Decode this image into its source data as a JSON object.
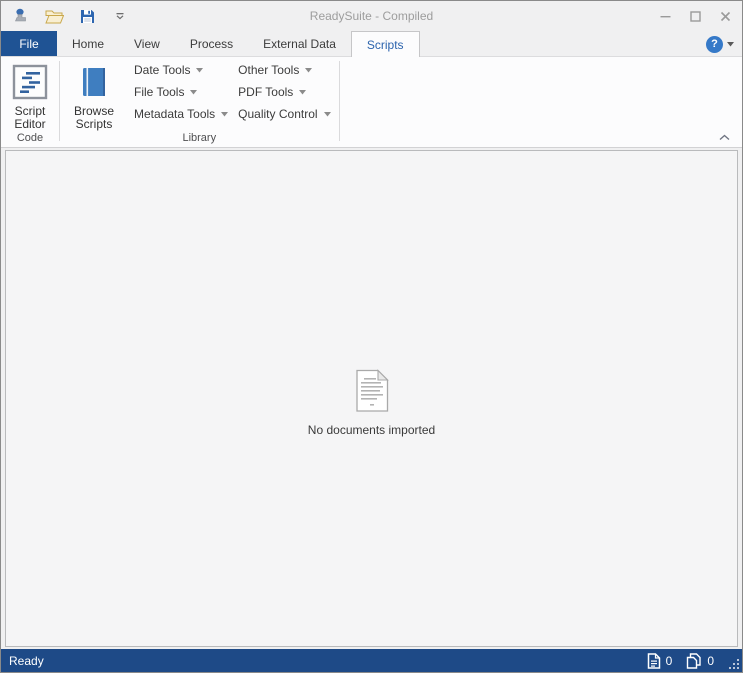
{
  "window": {
    "title": "ReadySuite - Compiled"
  },
  "tabs": {
    "items": [
      "File",
      "Home",
      "View",
      "Process",
      "External Data",
      "Scripts"
    ],
    "active": "Scripts"
  },
  "ribbon": {
    "groups": {
      "code": "Code",
      "library": "Library"
    },
    "buttons": {
      "script_editor": "Script Editor",
      "browse_scripts": "Browse Scripts"
    },
    "dropdowns": [
      "Date Tools",
      "File Tools",
      "Metadata Tools",
      "Other Tools",
      "PDF Tools",
      "Quality Control"
    ]
  },
  "help": {
    "glyph": "?"
  },
  "content": {
    "empty_message": "No documents imported"
  },
  "statusbar": {
    "status": "Ready",
    "documents_count": "0",
    "pages_count": "0"
  },
  "icons": {
    "quick_access": [
      "app-stamp-icon",
      "open-folder-icon",
      "save-icon",
      "qat-more-icon"
    ],
    "window_controls": [
      "minimize-icon",
      "maximize-icon",
      "close-icon"
    ],
    "ribbon": [
      "script-editor-icon",
      "browse-scripts-book-icon",
      "dropdown-caret-icon",
      "ribbon-collapse-chevron-icon"
    ],
    "content": [
      "empty-document-icon"
    ],
    "statusbar": [
      "document-count-icon",
      "page-count-icon",
      "resize-grip-icon"
    ]
  },
  "colors": {
    "file_tab": "#1f5394",
    "active_tab_text": "#2b63ad",
    "status_bar": "#1e4a87",
    "help_button": "#3579c8",
    "book_icon": "#3f7ec0",
    "code_lines": "#33639f",
    "folder_icon": "#c9a84c"
  }
}
